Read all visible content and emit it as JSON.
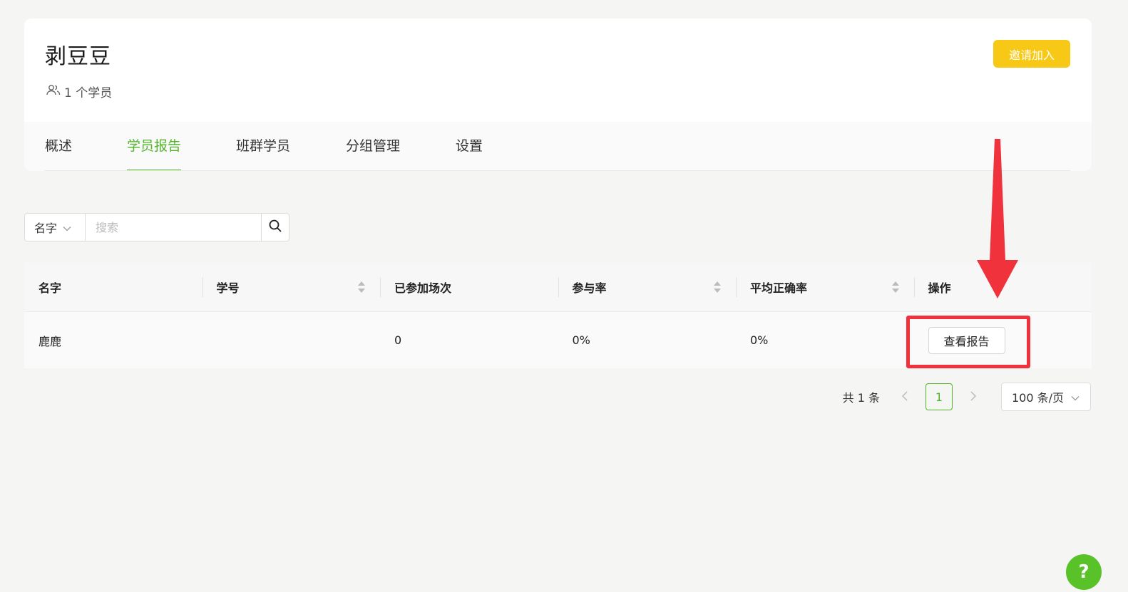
{
  "header": {
    "class_name": "剥豆豆",
    "member_count": "1 个学员",
    "invite_label": "邀请加入"
  },
  "tabs": [
    {
      "label": "概述",
      "active": false
    },
    {
      "label": "学员报告",
      "active": true
    },
    {
      "label": "班群学员",
      "active": false
    },
    {
      "label": "分组管理",
      "active": false
    },
    {
      "label": "设置",
      "active": false
    }
  ],
  "search": {
    "field_selected": "名字",
    "placeholder": "搜索",
    "value": ""
  },
  "table": {
    "columns": [
      {
        "label": "名字",
        "sortable": false
      },
      {
        "label": "学号",
        "sortable": true
      },
      {
        "label": "已参加场次",
        "sortable": false
      },
      {
        "label": "参与率",
        "sortable": true
      },
      {
        "label": "平均正确率",
        "sortable": true
      },
      {
        "label": "操作",
        "sortable": false
      }
    ],
    "rows": [
      {
        "name": "鹿鹿",
        "student_id": "",
        "sessions": "0",
        "participation": "0%",
        "accuracy": "0%",
        "action_label": "查看报告"
      }
    ]
  },
  "pagination": {
    "total": "共 1 条",
    "prev_icon": "chevron-left-icon",
    "current_page": "1",
    "next_icon": "chevron-right-icon",
    "page_size": "100 条/页"
  },
  "help": {
    "label": "?"
  },
  "colors": {
    "accent_green": "#52b42b",
    "invite_yellow": "#f7c916",
    "annotation_red": "#f0323c",
    "help_green": "#5ac229"
  }
}
